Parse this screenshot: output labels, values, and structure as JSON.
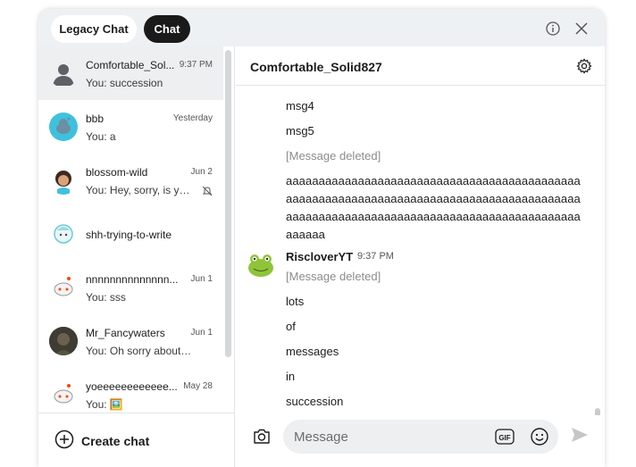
{
  "tabs": {
    "legacy": "Legacy Chat",
    "chat": "Chat"
  },
  "icons": {
    "info": "info-icon",
    "close": "close-icon",
    "settings": "gear-icon",
    "camera": "camera-icon",
    "gif": "gif-icon",
    "emoji": "smiley-icon",
    "send": "send-icon",
    "add": "plus-circle-icon",
    "mute": "bell-off-icon"
  },
  "conversations": [
    {
      "name": "Comfortable_Sol...",
      "time": "9:37 PM",
      "preview": "You: succession",
      "active": true
    },
    {
      "name": "bbb",
      "time": "Yesterday",
      "preview": "You: a"
    },
    {
      "name": "blossom-wild",
      "time": "Jun 2",
      "preview": "You: Hey, sorry, is yo...",
      "muted": true
    },
    {
      "name": "shh-trying-to-write",
      "time": "",
      "preview": ""
    },
    {
      "name": "nnnnnnnnnnnnnn...",
      "time": "Jun 1",
      "preview": "You: sss"
    },
    {
      "name": "Mr_Fancywaters",
      "time": "Jun 1",
      "preview": "You: Oh sorry about th..."
    },
    {
      "name": "yoeeeeeeeeeeee...",
      "time": "May 28",
      "preview": "You: 🖼️"
    }
  ],
  "create_chat": "Create chat",
  "chat": {
    "title": "Comfortable_Solid827",
    "messages_top": [
      "msg4",
      "msg5"
    ],
    "deleted_label": "[Message deleted]",
    "long_message": "aaaaaaaaaaaaaaaaaaaaaaaaaaaaaaaaaaaaaaaaaaaaaaaaaaaaaaaaaaaaaaaaaaaaaaaaaaaaaaaaaaaaaaaaaaaaaaaaaaaaaaaaaaaaaaaaaaaaaaaaaaaaaaaaaaaaaaaaaaaaa",
    "sender": {
      "name": "RiscloverYT",
      "time": "9:37 PM"
    },
    "messages_bottom": [
      "lots",
      "of",
      "messages",
      "in",
      "succession"
    ]
  },
  "composer": {
    "placeholder": "Message"
  }
}
